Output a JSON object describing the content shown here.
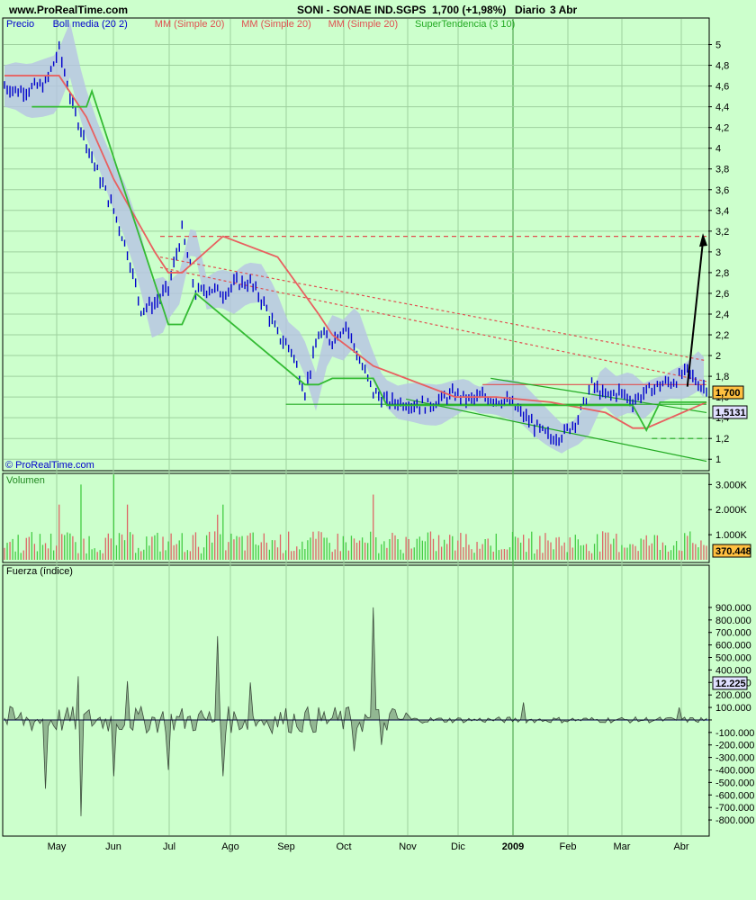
{
  "header": {
    "site": "www.ProRealTime.com",
    "instrument": "SONI - SONAE IND.SGPS",
    "price_change": "1,700 (+1,98%)",
    "period": "Diario",
    "date": "3 Abr"
  },
  "watermark": "© ProRealTime.com",
  "colors": {
    "background": "#ccffcc",
    "price": "#0000cc",
    "bollinger": "#b7c3e4",
    "ma": "#e86060",
    "supertrend": "#33bb33",
    "grid": "#9ed09e",
    "badge_price": "#ffc040",
    "badge_value": "#e0e0ff",
    "force_fill": "#7a9a7a"
  },
  "chart_data": [
    {
      "type": "line",
      "panel": "price",
      "legend": [
        {
          "label": "Precio",
          "color": "#0000cc"
        },
        {
          "label": "Boll media (20 2)",
          "color": "#0000cc"
        },
        {
          "label": "MM (Simple 20)",
          "color": "#e05050"
        },
        {
          "label": "MM (Simple 20)",
          "color": "#e05050"
        },
        {
          "label": "MM (Simple 20)",
          "color": "#e05050"
        },
        {
          "label": "SuperTendencia (3 10)",
          "color": "#22aa22"
        }
      ],
      "x_labels": [
        "May",
        "Jun",
        "Jul",
        "Ago",
        "Sep",
        "Oct",
        "Nov",
        "Dic",
        "2009",
        "Feb",
        "Mar",
        "Abr"
      ],
      "y_ticks": [
        "5",
        "4,8",
        "4,6",
        "4,4",
        "4,2",
        "4",
        "3,8",
        "3,6",
        "3,4",
        "3,2",
        "3",
        "2,8",
        "2,6",
        "2,4",
        "2,2",
        "2",
        "1,8",
        "1,6",
        "1,4",
        "1,2",
        "1"
      ],
      "ylim": [
        0.95,
        5.1
      ],
      "current_price_label": "1,700",
      "current_price": 1.7,
      "supertrend_label": "1,5131",
      "supertrend_value": 1.5131,
      "series": [
        {
          "name": "Precio",
          "t": [
            0,
            5,
            10,
            15,
            20,
            25,
            30,
            35,
            40,
            45,
            50,
            55,
            60,
            65,
            70,
            75,
            80,
            85,
            90,
            95,
            100,
            105,
            110,
            115,
            120,
            125,
            130,
            135,
            140,
            145,
            150,
            155,
            160,
            165,
            170,
            175,
            180,
            185,
            190,
            195,
            200,
            205,
            210,
            215,
            220,
            225,
            230,
            235,
            240,
            245,
            250,
            255,
            257
          ],
          "values": [
            4.6,
            4.55,
            4.58,
            4.62,
            4.95,
            4.4,
            4.05,
            3.7,
            3.4,
            3.0,
            2.45,
            2.5,
            2.65,
            3.2,
            2.6,
            2.65,
            2.6,
            2.7,
            2.7,
            2.5,
            2.2,
            2.05,
            1.65,
            2.2,
            2.15,
            2.3,
            1.95,
            1.65,
            1.55,
            1.55,
            1.53,
            1.52,
            1.58,
            1.63,
            1.57,
            1.6,
            1.58,
            1.55,
            1.42,
            1.3,
            1.2,
            1.25,
            1.4,
            1.72,
            1.6,
            1.65,
            1.56,
            1.65,
            1.72,
            1.75,
            1.85,
            1.7,
            1.7
          ]
        },
        {
          "name": "MM (Simple 20)",
          "t": [
            0,
            20,
            30,
            40,
            55,
            60,
            65,
            80,
            100,
            115,
            120,
            135,
            155,
            165,
            180,
            200,
            220,
            230,
            235,
            257
          ],
          "values": [
            4.7,
            4.7,
            4.3,
            3.7,
            3.0,
            2.8,
            2.8,
            3.15,
            2.95,
            2.4,
            2.2,
            1.9,
            1.7,
            1.6,
            1.6,
            1.55,
            1.45,
            1.3,
            1.3,
            1.55
          ]
        },
        {
          "name": "SuperTendencia (3 10)",
          "t": [
            10,
            30,
            32,
            60,
            65,
            70,
            110,
            115,
            120,
            135,
            140,
            160,
            230,
            235,
            240,
            257
          ],
          "values": [
            4.4,
            4.4,
            4.55,
            2.3,
            2.3,
            2.6,
            1.72,
            1.72,
            1.78,
            1.78,
            1.52,
            1.52,
            1.52,
            1.28,
            1.55,
            1.55
          ]
        }
      ]
    },
    {
      "type": "bar",
      "panel": "volume",
      "title": "Volumen",
      "y_ticks": [
        "3.000K",
        "2.000K",
        "1.000K"
      ],
      "current_value_label": "370.448",
      "current_value": 370448
    },
    {
      "type": "area",
      "panel": "force",
      "title": "Fuerza (índice)",
      "y_ticks": [
        "900.000",
        "800.000",
        "700.000",
        "600.000",
        "500.000",
        "400.000",
        "300.000",
        "200.000",
        "100.000",
        "0",
        "-100.000",
        "-200.000",
        "-300.000",
        "-400.000",
        "-500.000",
        "-600.000",
        "-700.000",
        "-800.000"
      ],
      "ylim": [
        -850000,
        950000
      ],
      "current_value_label": "12.225",
      "current_value": 12225,
      "spikes": [
        {
          "t": 15,
          "value": -550000
        },
        {
          "t": 27,
          "value": 350000
        },
        {
          "t": 28,
          "value": -770000
        },
        {
          "t": 40,
          "value": -450000
        },
        {
          "t": 45,
          "value": 310000
        },
        {
          "t": 60,
          "value": -400000
        },
        {
          "t": 78,
          "value": 670000
        },
        {
          "t": 80,
          "value": -450000
        },
        {
          "t": 90,
          "value": 300000
        },
        {
          "t": 128,
          "value": -250000
        },
        {
          "t": 135,
          "value": 900000
        },
        {
          "t": 138,
          "value": -200000
        },
        {
          "t": 190,
          "value": 140000
        },
        {
          "t": 247,
          "value": 100000
        }
      ]
    }
  ]
}
